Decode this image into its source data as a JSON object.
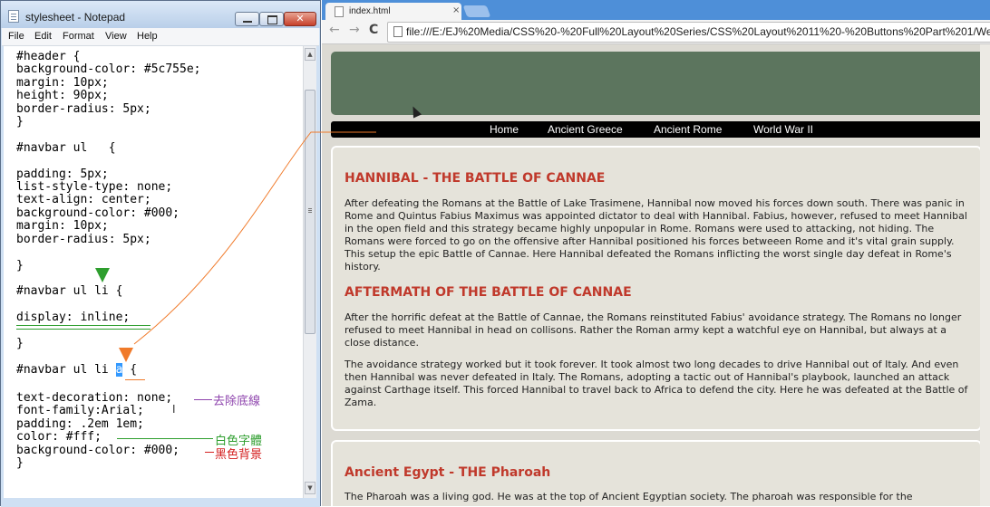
{
  "notepad": {
    "title": "stylesheet - Notepad",
    "close_glyph": "✕",
    "menu": [
      "File",
      "Edit",
      "Format",
      "View",
      "Help"
    ],
    "code_lines_1": "#header {\nbackground-color: #5c755e;\nmargin: 10px;\nheight: 90px;\nborder-radius: 5px;\n}\n\n#navbar ul   {\n\npadding: 5px;\nlist-style-type: none;\ntext-align: center;\nbackground-color: #000;\nmargin: 10px;\nborder-radius: 5px;\n\n}\n\n#navbar ul li {\n\ndisplay: inline;\n\n}\n\n#navbar ul li ",
    "selected_text": "a",
    "code_after_selection": " {",
    "code_lines_2": "text-decoration: none;\nfont-family:Arial;\npadding: .2em 1em;\ncolor: #fff;\nbackground-color: #000;\n}",
    "annotations": {
      "remove_underline": "去除底線",
      "white_text": "白色字體",
      "black_background": "黑色背景"
    },
    "annotation_colors": {
      "remove_underline": "#8e44ad",
      "white_text": "#2e9e2e",
      "black_background": "#d42020"
    }
  },
  "browser": {
    "tab_title": "index.html",
    "tab_close": "×",
    "back": "←",
    "forward": "→",
    "reload": "C",
    "url": "file:///E:/EJ%20Media/CSS%20-%20Full%20Layout%20Series/CSS%20Layout%2011%20-%20Buttons%20Part%201/We",
    "nav_items": [
      "Home",
      "Ancient Greece",
      "Ancient Rome",
      "World War II"
    ],
    "article1": {
      "heading1": "HANNIBAL - THE BATTLE OF CANNAE",
      "p1": "After defeating the Romans at the Battle of Lake Trasimene, Hannibal now moved his forces down south. There was panic in Rome and Quintus Fabius Maximus was appointed dictator to deal with Hannibal. Fabius, however, refused to meet Hannibal in the open field and this strategy became highly unpopular in Rome. Romans were used to attacking, not hiding. The Romans were forced to go on the offensive after Hannibal positioned his forces betweeen Rome and it's vital grain supply. This setup the epic Battle of Cannae. Here Hannibal defeated the Romans inflicting the worst single day defeat in Rome's history.",
      "heading2": "AFTERMATH OF THE BATTLE OF CANNAE",
      "p2": "After the horrific defeat at the Battle of Cannae, the Romans reinstituted Fabius' avoidance strategy. The Romans no longer refused to meet Hannibal in head on collisons. Rather the Roman army kept a watchful eye on Hannibal, but always at a close distance.",
      "p3": "The avoidance strategy worked but it took forever. It took almost two long decades to drive Hannibal out of Italy. And even then Hannibal was never defeated in Italy. The Romans, adopting a tactic out of Hannibal's playbook, launched an attack against Carthage itself. This forced Hannibal to travel back to Africa to defend the city. Here he was defeated at the Battle of Zama."
    },
    "article2": {
      "heading": "Ancient Egypt - THE Pharoah",
      "p1": "The Pharoah was a living god. He was at the top of Ancient Egyptian society. The pharoah was responsible for the"
    },
    "colors": {
      "header_bg": "#5c755e",
      "navbar_bg": "#000000",
      "heading_red": "#c0392b",
      "page_bg": "#dcdad3"
    }
  }
}
